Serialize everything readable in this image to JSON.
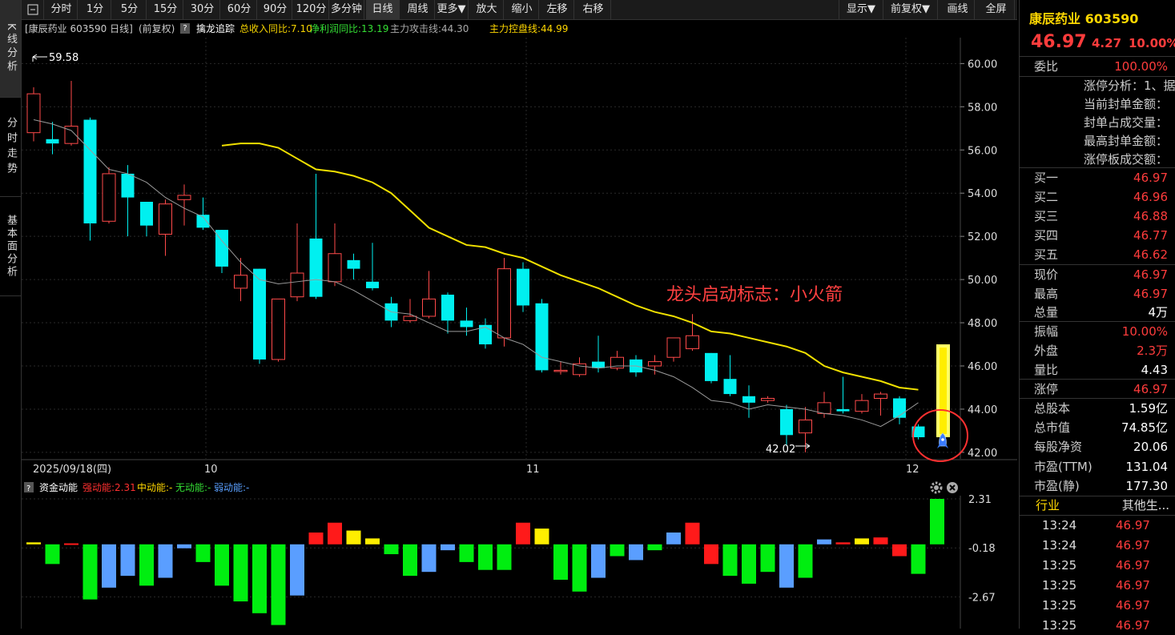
{
  "left_tabs": [
    "K线分析",
    "分时走势",
    "基本面分析"
  ],
  "toolbar": {
    "items": [
      "分时",
      "1分",
      "5分",
      "15分",
      "30分",
      "60分",
      "90分",
      "120分",
      "多分钟",
      "日线",
      "周线",
      "更多▼",
      "放大",
      "缩小",
      "左移",
      "右移"
    ],
    "right_items": [
      "显示▼",
      "前复权▼",
      "画线",
      "全屏"
    ]
  },
  "infobar": {
    "stock": "[康辰药业 603590 日线]",
    "adjust": "(前复权)",
    "help_icon": "?",
    "indicator": "擒龙追踪",
    "revenue": "总收入同比:7.10",
    "profit": "净利润同比:13.19",
    "attack": "主力攻击线:44.30",
    "control": "主力控盘线:44.99"
  },
  "price_axis": [
    "60.00",
    "58.00",
    "56.00",
    "54.00",
    "52.00",
    "50.00",
    "48.00",
    "46.00",
    "44.00",
    "42.00"
  ],
  "date_axis": {
    "start": "2025/09/18(四)",
    "m10": "10",
    "m11": "11",
    "m12": "12"
  },
  "annotations": {
    "high": "59.58",
    "low": "42.02",
    "rocket_text": "龙头启动标志：小火箭"
  },
  "chart_data": {
    "type": "candlestick",
    "candles": [
      {
        "o": 56.8,
        "c": 58.6,
        "h": 58.9,
        "l": 56.4
      },
      {
        "o": 56.5,
        "c": 56.3,
        "h": 57.3,
        "l": 55.8
      },
      {
        "o": 56.3,
        "c": 57.1,
        "h": 59.2,
        "l": 56.2
      },
      {
        "o": 57.4,
        "c": 52.6,
        "h": 57.5,
        "l": 51.8
      },
      {
        "o": 52.7,
        "c": 54.9,
        "h": 55.2,
        "l": 52.6
      },
      {
        "o": 54.9,
        "c": 53.8,
        "h": 55.3,
        "l": 52.0
      },
      {
        "o": 53.6,
        "c": 52.5,
        "h": 53.6,
        "l": 52.0
      },
      {
        "o": 52.1,
        "c": 53.5,
        "h": 53.7,
        "l": 51.1
      },
      {
        "o": 53.7,
        "c": 53.9,
        "h": 54.4,
        "l": 52.5
      },
      {
        "o": 53.0,
        "c": 52.4,
        "h": 53.8,
        "l": 52.3
      },
      {
        "o": 52.3,
        "c": 50.6,
        "h": 52.3,
        "l": 50.3
      },
      {
        "o": 49.6,
        "c": 50.2,
        "h": 51.0,
        "l": 49.0
      },
      {
        "o": 50.5,
        "c": 46.3,
        "h": 50.5,
        "l": 46.1
      },
      {
        "o": 46.3,
        "c": 49.1,
        "h": 49.1,
        "l": 46.2
      },
      {
        "o": 49.2,
        "c": 50.3,
        "h": 52.6,
        "l": 49.0
      },
      {
        "o": 51.9,
        "c": 49.2,
        "h": 54.9,
        "l": 49.1
      },
      {
        "o": 49.9,
        "c": 51.2,
        "h": 52.6,
        "l": 49.7
      },
      {
        "o": 50.9,
        "c": 50.5,
        "h": 51.2,
        "l": 50.0
      },
      {
        "o": 49.9,
        "c": 49.6,
        "h": 51.7,
        "l": 49.5
      },
      {
        "o": 48.9,
        "c": 48.1,
        "h": 49.2,
        "l": 47.8
      },
      {
        "o": 48.1,
        "c": 48.3,
        "h": 49.1,
        "l": 48.0
      },
      {
        "o": 48.3,
        "c": 49.1,
        "h": 50.4,
        "l": 48.2
      },
      {
        "o": 49.3,
        "c": 48.1,
        "h": 49.4,
        "l": 47.5
      },
      {
        "o": 48.1,
        "c": 47.8,
        "h": 48.7,
        "l": 47.4
      },
      {
        "o": 47.9,
        "c": 47.0,
        "h": 48.2,
        "l": 46.8
      },
      {
        "o": 47.3,
        "c": 50.5,
        "h": 51.0,
        "l": 46.9
      },
      {
        "o": 50.5,
        "c": 48.8,
        "h": 50.8,
        "l": 48.5
      },
      {
        "o": 48.9,
        "c": 45.8,
        "h": 49.1,
        "l": 45.7
      },
      {
        "o": 45.8,
        "c": 45.8,
        "h": 46.2,
        "l": 45.6
      },
      {
        "o": 45.6,
        "c": 46.1,
        "h": 46.4,
        "l": 45.5
      },
      {
        "o": 46.2,
        "c": 45.9,
        "h": 47.4,
        "l": 45.7
      },
      {
        "o": 45.9,
        "c": 46.4,
        "h": 46.7,
        "l": 45.8
      },
      {
        "o": 46.3,
        "c": 45.7,
        "h": 46.5,
        "l": 45.5
      },
      {
        "o": 46.0,
        "c": 46.2,
        "h": 46.5,
        "l": 45.6
      },
      {
        "o": 46.4,
        "c": 47.3,
        "h": 47.3,
        "l": 46.2
      },
      {
        "o": 46.8,
        "c": 47.4,
        "h": 48.4,
        "l": 46.7
      },
      {
        "o": 46.6,
        "c": 45.3,
        "h": 46.6,
        "l": 45.2
      },
      {
        "o": 45.4,
        "c": 44.7,
        "h": 46.5,
        "l": 44.6
      },
      {
        "o": 44.6,
        "c": 44.3,
        "h": 45.1,
        "l": 43.6
      },
      {
        "o": 44.4,
        "c": 44.5,
        "h": 44.6,
        "l": 44.3
      },
      {
        "o": 44.0,
        "c": 42.8,
        "h": 44.2,
        "l": 42.3
      },
      {
        "o": 42.9,
        "c": 43.5,
        "h": 44.1,
        "l": 42.0
      },
      {
        "o": 43.8,
        "c": 44.3,
        "h": 44.8,
        "l": 43.6
      },
      {
        "o": 44.0,
        "c": 43.9,
        "h": 45.5,
        "l": 43.8
      },
      {
        "o": 43.9,
        "c": 44.4,
        "h": 44.7,
        "l": 43.8
      },
      {
        "o": 44.5,
        "c": 44.7,
        "h": 44.8,
        "l": 43.7
      },
      {
        "o": 44.5,
        "c": 43.6,
        "h": 44.6,
        "l": 43.3
      },
      {
        "o": 43.2,
        "c": 42.7,
        "h": 43.3,
        "l": 42.6
      }
    ],
    "ma_yellow": [
      56.2,
      56.3,
      56.3,
      56.1,
      55.6,
      55.1,
      55.0,
      54.8,
      54.5,
      54.0,
      53.2,
      52.4,
      52.0,
      51.6,
      51.5,
      51.2,
      51.0,
      50.6,
      50.2,
      49.9,
      49.6,
      49.2,
      48.8,
      48.5,
      48.3,
      48.0,
      47.6,
      47.5,
      47.3,
      47.1,
      46.9,
      46.6,
      46.0,
      45.7,
      45.5,
      45.3,
      45.0,
      44.9
    ],
    "ma_gray": [
      57.4,
      57.2,
      56.9,
      56.0,
      55.1,
      54.9,
      54.5,
      53.8,
      53.3,
      52.9,
      51.8,
      50.8,
      50.0,
      49.8,
      49.9,
      50.0,
      49.9,
      49.5,
      49.0,
      48.5,
      48.4,
      48.0,
      47.6,
      47.6,
      47.8,
      47.3,
      47.0,
      46.4,
      46.2,
      46.0,
      45.9,
      46.0,
      46.0,
      45.8,
      45.5,
      45.0,
      44.4,
      44.3,
      44.0,
      44.2,
      44.1,
      44.0,
      43.8,
      43.7,
      43.5,
      43.2,
      43.7,
      44.3
    ],
    "highlight_bar": {
      "top": 47.0,
      "bottom": 42.7
    },
    "ylim": [
      41.7,
      61.2
    ],
    "sub_panel": {
      "title": "资金动能",
      "strong_label": "强动能:2.31",
      "mid_label": "中动能:-",
      "none_label": "无动能:-",
      "weak_label": "弱动能:-",
      "axis": [
        "2.31",
        "-0.18",
        "-2.67"
      ],
      "values": [
        0.1,
        -1.0,
        0.05,
        -2.8,
        -2.2,
        -1.6,
        -2.1,
        -1.7,
        -0.2,
        -0.9,
        -2.1,
        -2.9,
        -3.5,
        -4.1,
        -2.6,
        0.6,
        1.1,
        0.7,
        0.3,
        -0.5,
        -1.6,
        -1.4,
        -0.3,
        -0.9,
        -1.3,
        -1.3,
        1.1,
        0.8,
        -1.8,
        -2.4,
        -1.7,
        -0.6,
        -0.8,
        -0.3,
        0.6,
        1.1,
        -1.0,
        -1.6,
        -2.0,
        -1.4,
        -2.2,
        -1.7,
        0.25,
        0.1,
        0.3,
        0.35,
        -0.6,
        -1.5,
        2.31
      ],
      "colors": [
        "yellow",
        "green",
        "red",
        "green",
        "blue",
        "blue",
        "green",
        "blue",
        "blue",
        "green",
        "green",
        "green",
        "green",
        "green",
        "blue",
        "red",
        "red",
        "yellow",
        "yellow",
        "green",
        "green",
        "blue",
        "blue",
        "green",
        "green",
        "green",
        "red",
        "yellow",
        "green",
        "green",
        "blue",
        "green",
        "blue",
        "green",
        "blue",
        "red",
        "red",
        "green",
        "green",
        "green",
        "blue",
        "green",
        "blue",
        "red",
        "yellow",
        "red",
        "red",
        "green",
        "green",
        "red"
      ]
    }
  },
  "right_panel": {
    "name": "康辰药业 603590",
    "price": "46.97",
    "change": "4.27",
    "pct": "10.00%",
    "weibi_label": "委比",
    "weibi": "100.00%",
    "limit_lines": [
      "涨停分析：1、据",
      "当前封单金额：",
      "封单占成交量：",
      "最高封单金额：",
      "涨停板成交额："
    ],
    "bids": [
      {
        "label": "买一",
        "value": "46.97"
      },
      {
        "label": "买二",
        "value": "46.96"
      },
      {
        "label": "买三",
        "value": "46.88"
      },
      {
        "label": "买四",
        "value": "46.77"
      },
      {
        "label": "买五",
        "value": "46.62"
      }
    ],
    "quote1": [
      {
        "label": "现价",
        "value": "46.97",
        "color": "red"
      },
      {
        "label": "最高",
        "value": "46.97",
        "color": "red"
      },
      {
        "label": "总量",
        "value": "4万",
        "color": "white"
      }
    ],
    "quote2": [
      {
        "label": "振幅",
        "value": "10.00%",
        "color": "red"
      },
      {
        "label": "外盘",
        "value": "2.3万",
        "color": "red"
      },
      {
        "label": "量比",
        "value": "4.43",
        "color": "white"
      }
    ],
    "quote3": [
      {
        "label": "涨停",
        "value": "46.97",
        "color": "red"
      }
    ],
    "fundamentals": [
      {
        "label": "总股本",
        "value": "1.59亿"
      },
      {
        "label": "总市值",
        "value": "74.85亿"
      },
      {
        "label": "每股净资",
        "value": "20.06"
      },
      {
        "label": "市盈(TTM)",
        "value": "131.04"
      },
      {
        "label": "市盈(静)",
        "value": "177.30"
      }
    ],
    "industry_label": "行业",
    "industry": "其他生...",
    "ticks": [
      {
        "time": "13:24",
        "price": "46.97"
      },
      {
        "time": "13:24",
        "price": "46.97"
      },
      {
        "time": "13:25",
        "price": "46.97"
      },
      {
        "time": "13:25",
        "price": "46.97"
      },
      {
        "time": "13:25",
        "price": "46.97"
      },
      {
        "time": "13:25",
        "price": "46.97"
      }
    ]
  }
}
